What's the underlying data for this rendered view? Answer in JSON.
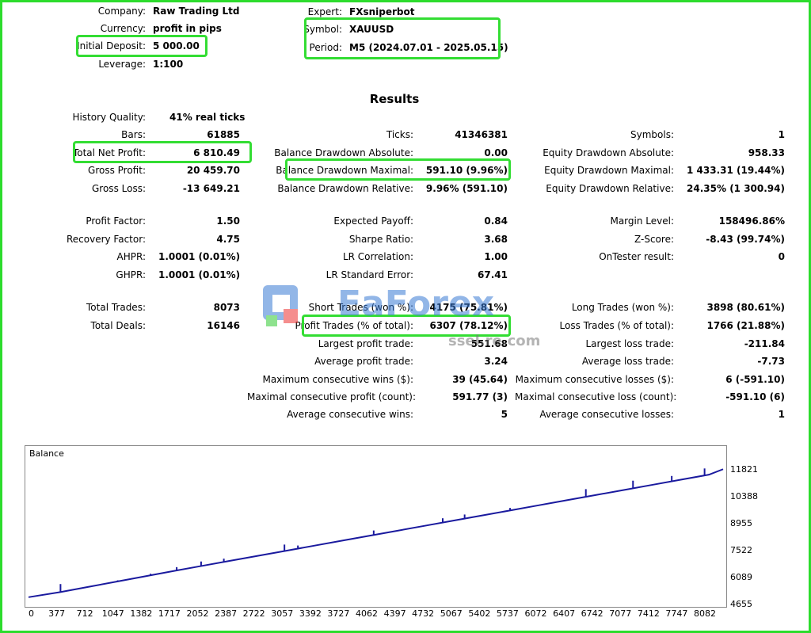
{
  "header": {
    "company_label": "Company:",
    "company": "Raw Trading Ltd",
    "currency_label": "Currency:",
    "currency": "profit in pips",
    "deposit_label": "Initial Deposit:",
    "deposit": "5 000.00",
    "leverage_label": "Leverage:",
    "leverage": "1:100",
    "expert_label": "Expert:",
    "expert": "FXsniperbot",
    "symbol_label": "Symbol:",
    "symbol": "XAUUSD",
    "period_label": "Period:",
    "period": "M5 (2024.07.01 - 2025.05.15)"
  },
  "results_title": "Results",
  "stats": {
    "history_quality_label": "History Quality:",
    "history_quality": "41% real ticks",
    "bars_label": "Bars:",
    "bars": "61885",
    "ticks_label": "Ticks:",
    "ticks": "41346381",
    "symbols_label": "Symbols:",
    "symbols": "1",
    "net_profit_label": "Total Net Profit:",
    "net_profit": "6 810.49",
    "bal_dd_abs_label": "Balance Drawdown Absolute:",
    "bal_dd_abs": "0.00",
    "eq_dd_abs_label": "Equity Drawdown Absolute:",
    "eq_dd_abs": "958.33",
    "gross_profit_label": "Gross Profit:",
    "gross_profit": "20 459.70",
    "bal_dd_max_label": "Balance Drawdown Maximal:",
    "bal_dd_max": "591.10 (9.96%)",
    "eq_dd_max_label": "Equity Drawdown Maximal:",
    "eq_dd_max": "1 433.31 (19.44%)",
    "gross_loss_label": "Gross Loss:",
    "gross_loss": "-13 649.21",
    "bal_dd_rel_label": "Balance Drawdown Relative:",
    "bal_dd_rel": "9.96% (591.10)",
    "eq_dd_rel_label": "Equity Drawdown Relative:",
    "eq_dd_rel": "24.35% (1 300.94)",
    "profit_factor_label": "Profit Factor:",
    "profit_factor": "1.50",
    "expected_payoff_label": "Expected Payoff:",
    "expected_payoff": "0.84",
    "margin_level_label": "Margin Level:",
    "margin_level": "158496.86%",
    "recovery_factor_label": "Recovery Factor:",
    "recovery_factor": "4.75",
    "sharpe_label": "Sharpe Ratio:",
    "sharpe": "3.68",
    "zscore_label": "Z-Score:",
    "zscore": "-8.43 (99.74%)",
    "ahpr_label": "AHPR:",
    "ahpr": "1.0001 (0.01%)",
    "lr_corr_label": "LR Correlation:",
    "lr_corr": "1.00",
    "ontester_label": "OnTester result:",
    "ontester": "0",
    "ghpr_label": "GHPR:",
    "ghpr": "1.0001 (0.01%)",
    "lr_std_label": "LR Standard Error:",
    "lr_std": "67.41",
    "total_trades_label": "Total Trades:",
    "total_trades": "8073",
    "short_trades_label": "Short Trades (won %):",
    "short_trades": "4175 (75.81%)",
    "long_trades_label": "Long Trades (won %):",
    "long_trades": "3898 (80.61%)",
    "total_deals_label": "Total Deals:",
    "total_deals": "16146",
    "profit_trades_label": "Profit Trades (% of total):",
    "profit_trades": "6307 (78.12%)",
    "loss_trades_label": "Loss Trades (% of total):",
    "loss_trades": "1766 (21.88%)",
    "largest_profit_label": "Largest profit trade:",
    "largest_profit": "551.68",
    "largest_loss_label": "Largest loss trade:",
    "largest_loss": "-211.84",
    "avg_profit_label": "Average profit trade:",
    "avg_profit": "3.24",
    "avg_loss_label": "Average loss trade:",
    "avg_loss": "-7.73",
    "max_cons_wins_label": "Maximum consecutive wins ($):",
    "max_cons_wins": "39 (45.64)",
    "max_cons_losses_label": "Maximum consecutive losses ($):",
    "max_cons_losses": "6 (-591.10)",
    "maximal_cons_profit_label": "Maximal consecutive profit (count):",
    "maximal_cons_profit": "591.77 (3)",
    "maximal_cons_loss_label": "Maximal consecutive loss (count):",
    "maximal_cons_loss": "-591.10 (6)",
    "avg_cons_wins_label": "Average consecutive wins:",
    "avg_cons_wins": "5",
    "avg_cons_losses_label": "Average consecutive losses:",
    "avg_cons_losses": "1"
  },
  "watermark": {
    "brand": "EaForex",
    "domain": "ssel.re.com"
  },
  "colors": {
    "highlight": "#33dd33",
    "line": "#1a1a9e",
    "frame": "#2ddc2d"
  },
  "chart_data": {
    "type": "line",
    "title": "Balance",
    "x_ticks": [
      "0",
      "377",
      "712",
      "1047",
      "1382",
      "1717",
      "2052",
      "2387",
      "2722",
      "3057",
      "3392",
      "3727",
      "4062",
      "4397",
      "4732",
      "5067",
      "5402",
      "5737",
      "6072",
      "6407",
      "6742",
      "7077",
      "7412",
      "7747",
      "8082"
    ],
    "y_ticks": [
      "11821",
      "10388",
      "8955",
      "7522",
      "6089",
      "4655"
    ],
    "xlim": [
      0,
      8250
    ],
    "ylim": [
      4655,
      12200
    ],
    "series": [
      {
        "x": [
          0,
          377,
          712,
          1047,
          1382,
          1717,
          2052,
          2387,
          2722,
          3057,
          3392,
          3727,
          4062,
          4397,
          4732,
          5067,
          5402,
          5737,
          6072,
          6407,
          6742,
          7077,
          7412,
          7747,
          8082,
          8250
        ],
        "values": [
          5000,
          5270,
          5550,
          5830,
          6110,
          6390,
          6660,
          6930,
          7200,
          7470,
          7740,
          8010,
          8280,
          8550,
          8820,
          9090,
          9360,
          9630,
          9900,
          10170,
          10440,
          10710,
          10980,
          11250,
          11520,
          11810
        ]
      }
    ],
    "spikes": [
      {
        "x": 380,
        "y": 5700
      },
      {
        "x": 1060,
        "y": 5900
      },
      {
        "x": 1450,
        "y": 6250
      },
      {
        "x": 1760,
        "y": 6600
      },
      {
        "x": 2050,
        "y": 6900
      },
      {
        "x": 2320,
        "y": 7050
      },
      {
        "x": 3040,
        "y": 7800
      },
      {
        "x": 3200,
        "y": 7750
      },
      {
        "x": 4100,
        "y": 8550
      },
      {
        "x": 4920,
        "y": 9200
      },
      {
        "x": 5180,
        "y": 9400
      },
      {
        "x": 5720,
        "y": 9750
      },
      {
        "x": 6620,
        "y": 10750
      },
      {
        "x": 7180,
        "y": 11200
      },
      {
        "x": 7640,
        "y": 11450
      },
      {
        "x": 8030,
        "y": 11850
      }
    ]
  }
}
